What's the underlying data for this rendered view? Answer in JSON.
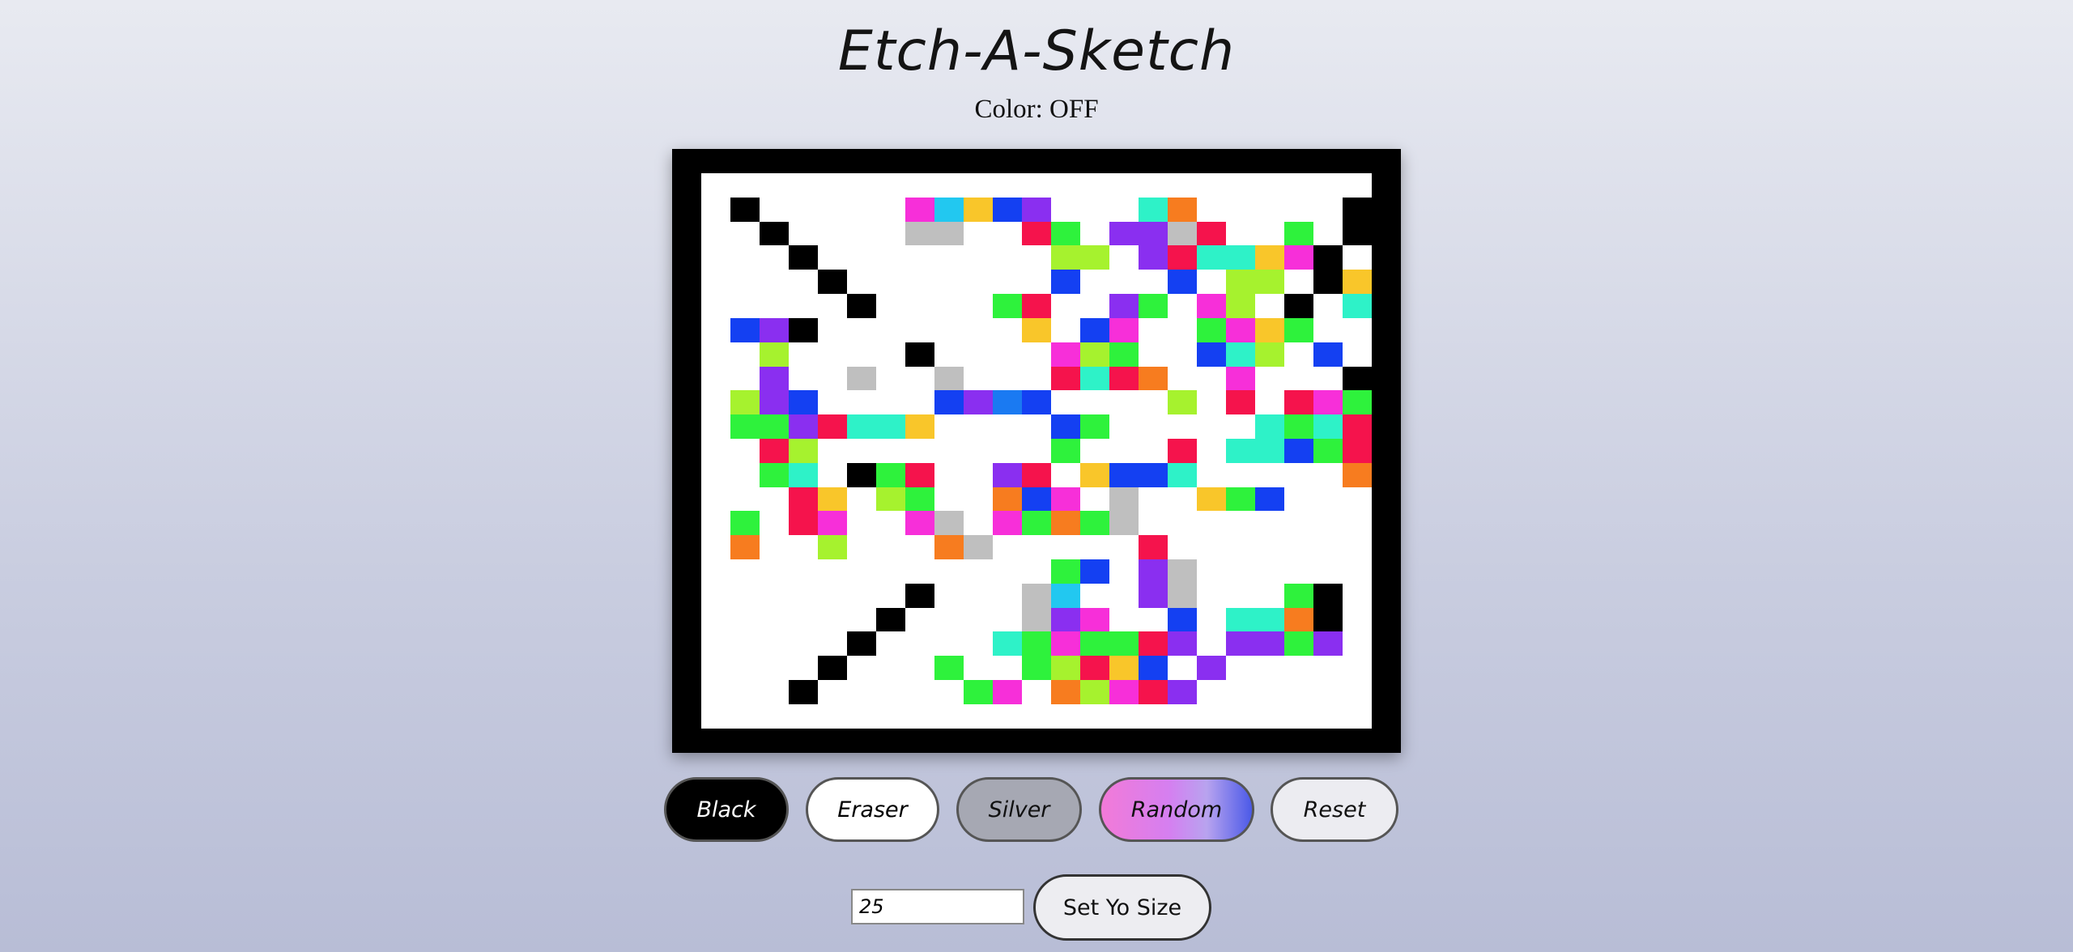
{
  "header": {
    "title": "Etch-A-Sketch",
    "color_status": "Color: OFF"
  },
  "board": {
    "grid_size": 25,
    "cells": [
      "0000000000000000000000000",
      "0K00000MCYBV000TO00000K00",
      "00K0000SS00RG0VVSR00G0K00",
      "000K00000000LL0VRTTYMK000",
      "0000K0000000B000B0LL0KY00",
      "00000K0000GR00VG0ML0K0TL0",
      "0BVK0000000Y0BM00GMYG00G0",
      "00L0000K0000MLG00BTL0B0YRT",
      "00V00S00S000RTRO00M000K0Y0",
      "0LVB0000BVAB0000L0R0RMG00",
      "0GGVRTTY0000BG00000TGTR000",
      "00RL00000000G000R0TTBGR0M",
      "00GT0KGR00VR0YBBT00000OBO",
      "000RY0LG00OBM0S00YGB0000",
      "0G0RM00MS0MGOGS00000000O0",
      "0O00L000OS00000R0000000MBO",
      "000000000000GB0VS000000R00",
      "0000000K000SC00VS000GK000",
      "000000K0000SVM00B0TTOK00S0",
      "00000K0000TGMGGRV0VVGV00K0",
      "0000K000G00GLRYB0V0000000K0",
      "000K00000GM0OLMRV00000000K0",
      "00000000000000000000000000"
    ]
  },
  "colors": {
    "0": "#ffffff",
    "K": "#000000",
    "M": "#f72fd9",
    "C": "#22c8f0",
    "Y": "#f9c62a",
    "B": "#1440f2",
    "V": "#8a2ff0",
    "S": "#bfbfbf",
    "R": "#f5134c",
    "G": "#2ef23c",
    "T": "#2ef2c8",
    "O": "#f77c1f",
    "L": "#a6f22e",
    "A": "#1a7af2"
  },
  "buttons": {
    "black": "Black",
    "eraser": "Eraser",
    "silver": "Silver",
    "random": "Random",
    "reset": "Reset",
    "set_size": "Set Yo Size"
  },
  "size_input": {
    "value": "25"
  }
}
